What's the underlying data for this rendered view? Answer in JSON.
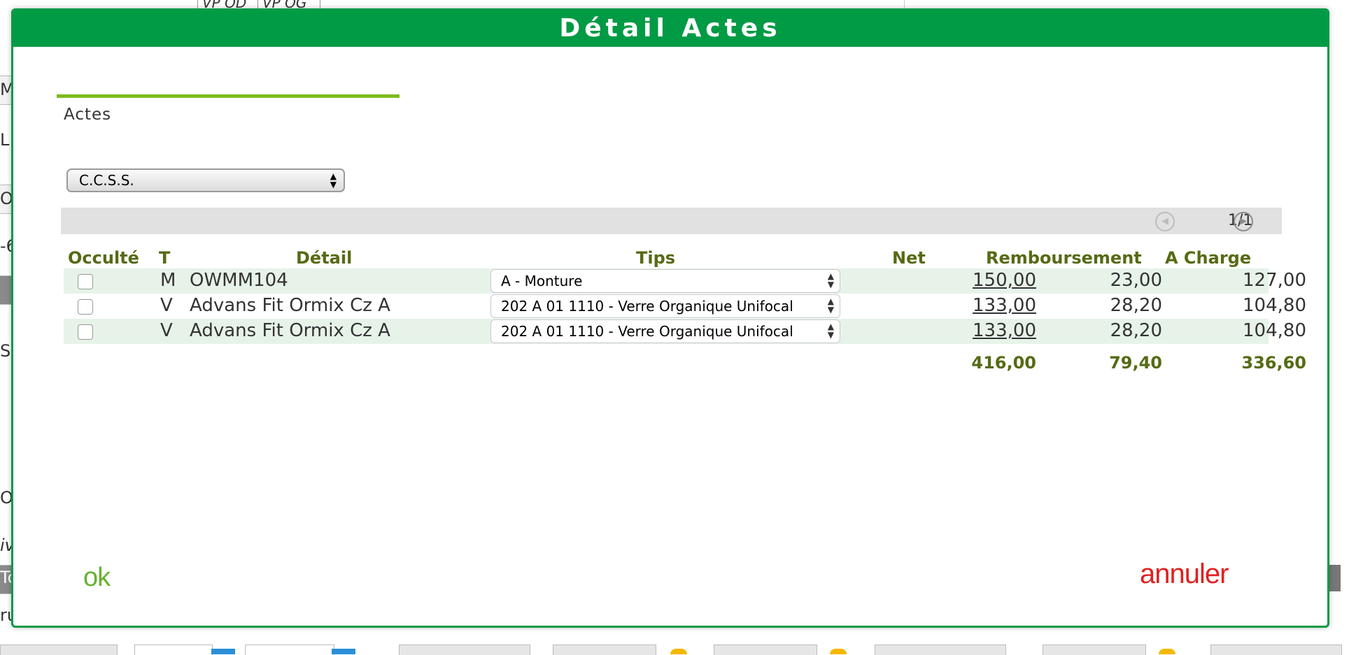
{
  "background": {
    "top_cells": [
      "VP OD",
      "VP OG"
    ],
    "left_fragments": [
      "M",
      "L",
      "O",
      "-6",
      "Su",
      "O",
      "iv",
      "To",
      "ru"
    ]
  },
  "modal": {
    "title": "Détail Actes",
    "section_title": "Actes",
    "organisme_select": {
      "value": "C.C.S.S."
    },
    "pager": {
      "text": "1/1"
    },
    "columns": {
      "occulte": "Occulté",
      "type": "T",
      "detail": "Détail",
      "tips": "Tips",
      "net": "Net",
      "remboursement": "Remboursement",
      "a_charge": "A Charge"
    },
    "rows": [
      {
        "type": "M",
        "detail": "OWMM104",
        "tips": "A - Monture",
        "net": "150,00",
        "remboursement": "23,00",
        "a_charge": "127,00"
      },
      {
        "type": "V",
        "detail": "Advans Fit Ormix Cz A",
        "tips": "202 A 01 1110 - Verre Organique Unifocal",
        "net": "133,00",
        "remboursement": "28,20",
        "a_charge": "104,80"
      },
      {
        "type": "V",
        "detail": "Advans Fit Ormix Cz A",
        "tips": "202 A 01 1110 - Verre Organique Unifocal",
        "net": "133,00",
        "remboursement": "28,20",
        "a_charge": "104,80"
      }
    ],
    "totals": {
      "net": "416,00",
      "remboursement": "79,40",
      "a_charge": "336,60"
    },
    "ok_label": "ok",
    "cancel_label": "annuler"
  },
  "colors": {
    "header_green": "#019a45",
    "section_rule": "#7dbb1f",
    "column_header": "#556b14",
    "ok": "#66b12f",
    "cancel": "#e02020"
  }
}
